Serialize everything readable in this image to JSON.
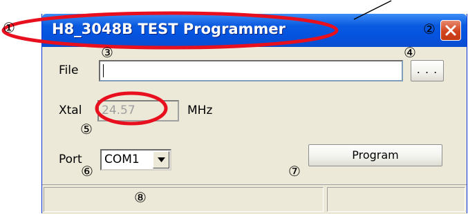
{
  "window": {
    "title": "H8_3048B TEST Programmer",
    "title_color": "#ffffff",
    "titlebar_color": "#0a55e0",
    "close_button_color": "#d2441f"
  },
  "form": {
    "file_label": "File",
    "file_value": "",
    "browse_label": ". . .",
    "xtal_label": "Xtal",
    "xtal_value": "24.57",
    "xtal_unit": "MHz",
    "port_label": "Port",
    "port_value": "COM1",
    "program_label": "Program"
  },
  "statusbar": {
    "pane1_text": "",
    "pane2_text": ""
  },
  "callouts": {
    "n1": "①",
    "n2": "②",
    "n3": "③",
    "n4": "④",
    "n5": "⑤",
    "n6": "⑥",
    "n7": "⑦",
    "n8": "⑧",
    "highlight_color": "#e8101e"
  }
}
